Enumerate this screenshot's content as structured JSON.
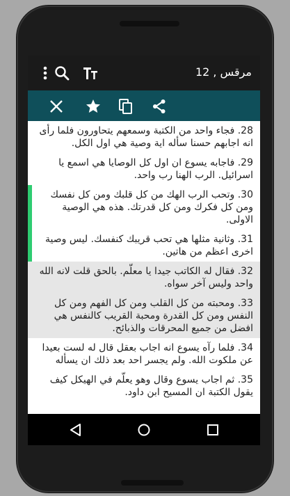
{
  "app": {
    "title": "مرقس , 12"
  },
  "toolbar": {
    "icons": [
      "text-size-icon",
      "search-icon",
      "more-vert-icon"
    ]
  },
  "selection_bar": {
    "icons": [
      "share-icon",
      "copy-icon",
      "star-icon",
      "close-icon"
    ],
    "color": "#0f4f5a"
  },
  "verses": [
    {
      "num": "28",
      "text": "فجاء واحد من الكتبة وسمعهم يتحاورون فلما رأى انه اجابهم حسنا سأله اية وصية هي اول الكل."
    },
    {
      "num": "29",
      "text": "فاجابه يسوع ان اول كل الوصايا هي اسمع يا اسرائيل. الرب الهنا رب واحد."
    },
    {
      "num": "30",
      "text": "وتحب الرب الهك من كل قلبك ومن كل نفسك ومن كل فكرك ومن كل قدرتك. هذه هي الوصية الاولى."
    },
    {
      "num": "31",
      "text": "وثانية مثلها هي تحب قريبك كنفسك. ليس وصية اخرى اعظم من هاتين."
    },
    {
      "num": "32",
      "text": "فقال له الكاتب جيدا يا معلّم. بالحق قلت لانه الله واحد وليس آخر سواه."
    },
    {
      "num": "33",
      "text": "ومحبته من كل القلب ومن كل الفهم ومن كل النفس ومن كل القدرة ومحبة القريب كالنفس هي افضل من جميع المحرقات والذبائح."
    },
    {
      "num": "34",
      "text": "فلما رآه يسوع انه اجاب بعقل قال له لست بعيدا عن ملكوت الله. ولم يجسر احد بعد ذلك ان يسأله"
    },
    {
      "num": "35",
      "text": "ثم اجاب يسوع وقال وهو يعلّم في الهيكل كيف يقول الكتبة ان المسيح ابن داود."
    }
  ],
  "colors": {
    "highlight": "#2ecc71",
    "selected_bg": "#e6e6e6"
  },
  "navbar": {
    "icons": [
      "back-icon",
      "home-icon",
      "recents-icon"
    ]
  }
}
